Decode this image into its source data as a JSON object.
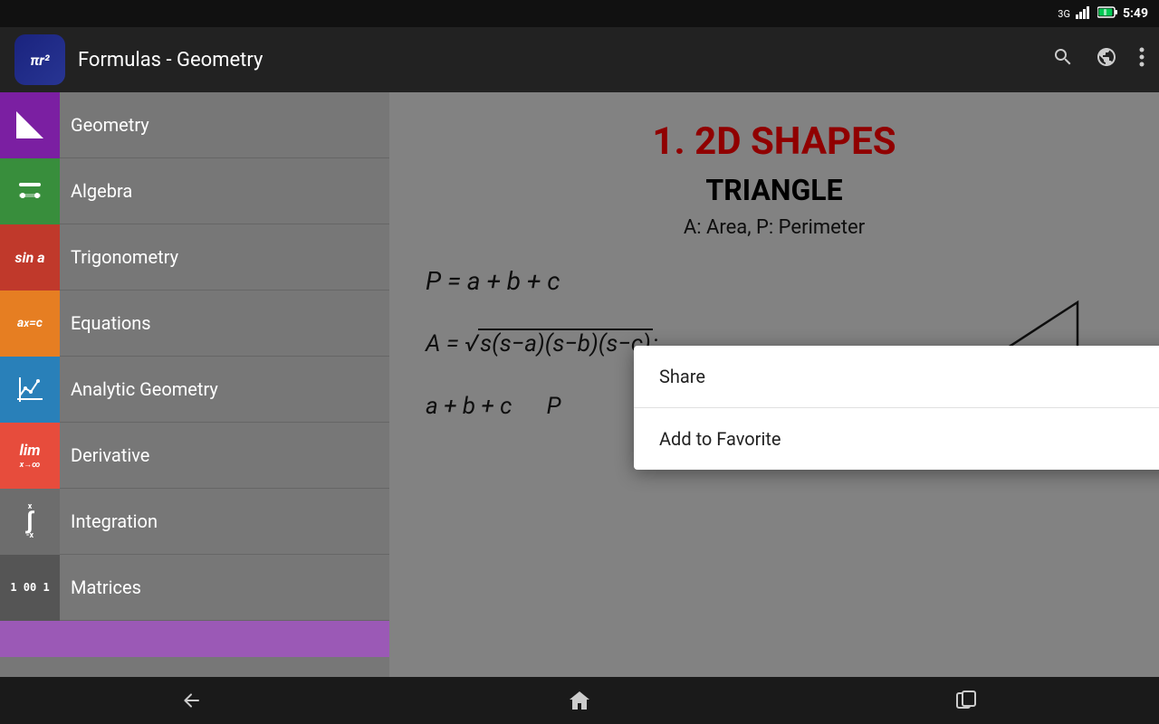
{
  "statusBar": {
    "signal": "3G",
    "time": "5:49",
    "batteryIcon": "🔋"
  },
  "appBar": {
    "iconText": "πr²",
    "title": "Formulas - Geometry",
    "searchLabel": "search",
    "globeLabel": "language",
    "menuLabel": "more options"
  },
  "sidebar": {
    "items": [
      {
        "id": "geometry",
        "label": "Geometry",
        "iconClass": "icon-geometry",
        "iconText": "◤"
      },
      {
        "id": "algebra",
        "label": "Algebra",
        "iconClass": "icon-algebra",
        "iconText": "÷"
      },
      {
        "id": "trigonometry",
        "label": "Trigonometry",
        "iconClass": "icon-trigonometry",
        "iconText": "sin a"
      },
      {
        "id": "equations",
        "label": "Equations",
        "iconClass": "icon-equations",
        "iconText": "aˣ=c"
      },
      {
        "id": "analytic",
        "label": "Analytic Geometry",
        "iconClass": "icon-analytic",
        "iconText": "⊹"
      },
      {
        "id": "derivative",
        "label": "Derivative",
        "iconClass": "icon-derivative",
        "iconText": "lim"
      },
      {
        "id": "integration",
        "label": "Integration",
        "iconClass": "icon-integration",
        "iconText": "∫"
      },
      {
        "id": "matrices",
        "label": "Matrices",
        "iconClass": "icon-matrices",
        "iconText": "[]"
      }
    ]
  },
  "content": {
    "title": "1. 2D SHAPES",
    "subtitle": "TRIANGLE",
    "description": "A: Area, P: Perimeter",
    "formula1": "P = a + b + c",
    "formula2": "A = √s(s−a)(s−b)(s−c);",
    "formula3": "a + b + c    P"
  },
  "contextMenu": {
    "items": [
      {
        "id": "share",
        "label": "Share"
      },
      {
        "id": "favorite",
        "label": "Add to Favorite"
      }
    ]
  },
  "bottomNav": {
    "back": "←",
    "home": "⌂",
    "recent": "▭"
  }
}
